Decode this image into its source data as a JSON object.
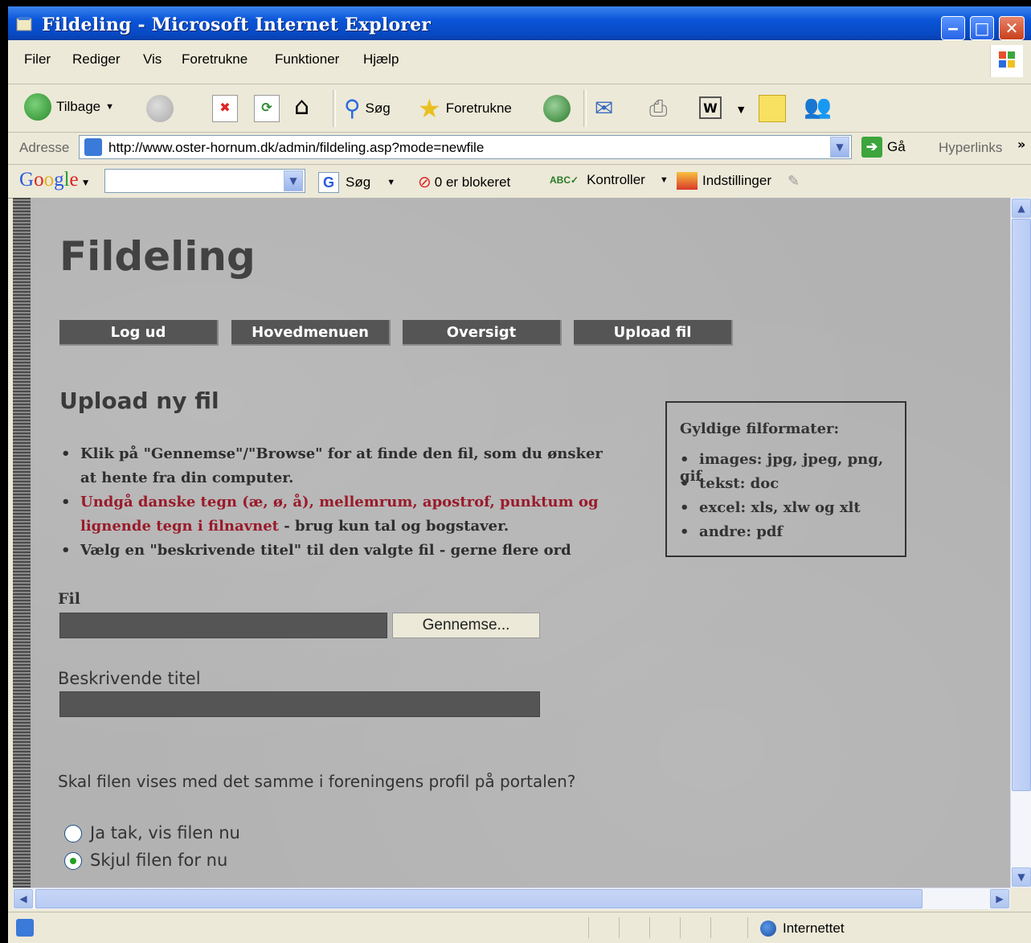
{
  "window": {
    "title": "Fildeling - Microsoft Internet Explorer"
  },
  "menu": [
    "Filer",
    "Rediger",
    "Vis",
    "Foretrukne",
    "Funktioner",
    "Hjælp"
  ],
  "toolbar": {
    "back": "Tilbage",
    "search": "Søg",
    "favorites": "Foretrukne"
  },
  "address": {
    "label": "Adresse",
    "url": "http://www.oster-hornum.dk/admin/fildeling.asp?mode=newfile",
    "go": "Gå",
    "links": "Hyperlinks"
  },
  "google": {
    "logo": "Google",
    "search": "Søg",
    "blocked": "0 er blokeret",
    "check": "Kontroller",
    "settings": "Indstillinger"
  },
  "page": {
    "title": "Fildeling",
    "nav": [
      "Log ud",
      "Hovedmenuen",
      "Oversigt",
      "Upload fil"
    ],
    "heading": "Upload ny fil",
    "bullets": {
      "b1": "Klik på \"Gennemse\"/\"Browse\" for at finde den fil, som du ønsker at hente fra din computer.",
      "b2_red": "Undgå danske tegn (æ, ø, å), mellemrum, apostrof, punktum og lignende tegn i filnavnet",
      "b2_rest": " - brug kun tal og bogstaver.",
      "b3": "Vælg en \"beskrivende titel\" til den valgte fil - gerne flere ord"
    },
    "formats": {
      "heading": "Gyldige filformater:",
      "items": [
        "images: jpg, jpeg, png, gif",
        "tekst: doc",
        "excel: xls, xlw og xlt",
        "andre: pdf"
      ]
    },
    "file_label": "Fil",
    "browse_button": "Gennemse...",
    "title_label": "Beskrivende titel",
    "question": "Skal filen vises med det samme i foreningens profil på portalen?",
    "radio_yes": "Ja tak, vis filen nu",
    "radio_no": "Skjul filen for nu",
    "radio_selected": "Skjul filen for nu"
  },
  "status": {
    "zone": "Internettet"
  }
}
